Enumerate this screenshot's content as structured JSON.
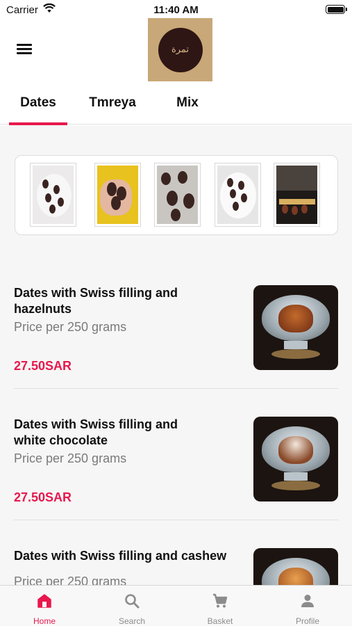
{
  "status_bar": {
    "carrier": "Carrier",
    "time": "11:40 AM"
  },
  "header": {
    "logo_text": "تمرة"
  },
  "tabs": [
    {
      "label": "Dates",
      "active": true
    },
    {
      "label": "Tmreya",
      "active": false
    },
    {
      "label": "Mix",
      "active": false
    }
  ],
  "products": [
    {
      "name": "Dates with Swiss filling and hazelnuts",
      "unit": "Price per 250 grams",
      "price": "27.50SAR"
    },
    {
      "name": "Dates with Swiss filling and white chocolate",
      "unit": "Price per 250 grams",
      "price": "27.50SAR"
    },
    {
      "name": "Dates with Swiss filling and cashew",
      "unit": "Price per 250 grams",
      "price": ""
    }
  ],
  "tabbar": [
    {
      "label": "Home",
      "icon": "home-icon",
      "active": true
    },
    {
      "label": "Search",
      "icon": "search-icon",
      "active": false
    },
    {
      "label": "Basket",
      "icon": "cart-icon",
      "active": false
    },
    {
      "label": "Profile",
      "icon": "person-icon",
      "active": false
    }
  ],
  "colors": {
    "accent": "#e8184d",
    "logo_bg": "#c8a878",
    "logo_circle": "#2e1614",
    "muted_text": "#7a7a7a"
  }
}
